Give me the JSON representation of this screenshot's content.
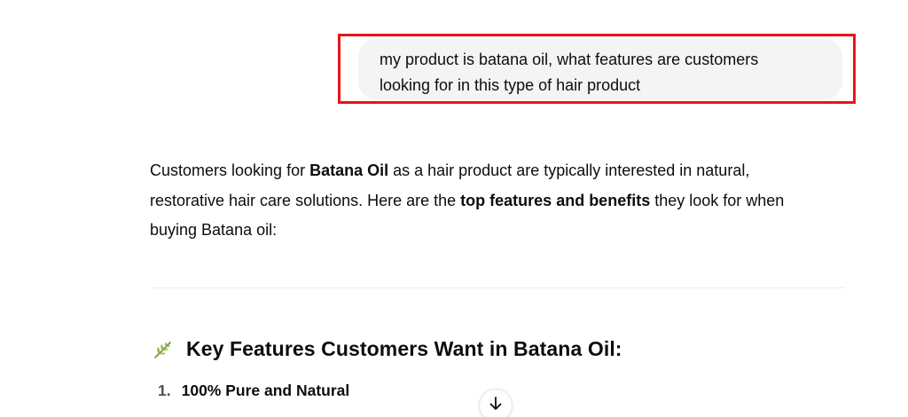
{
  "user_message": {
    "line1": "my product is batana oil, what features are customers",
    "line2": "looking for in this type of hair product",
    "highlight_color": "#e8141b"
  },
  "assistant": {
    "intro": {
      "p1": "Customers looking for ",
      "b1": "Batana Oil",
      "p2": " as a hair product are typically interested in natural,",
      "p3": "restorative hair care solutions. Here are the ",
      "b2": "top features and benefits",
      "p4": " they look for when",
      "p5": "buying Batana oil:"
    },
    "section": {
      "icon": "herb-icon",
      "heading": "Key Features Customers Want in Batana Oil:"
    },
    "list": [
      {
        "num": "1.",
        "label": "100% Pure and Natural"
      }
    ]
  },
  "controls": {
    "scroll_down_icon": "arrow-down-icon"
  }
}
